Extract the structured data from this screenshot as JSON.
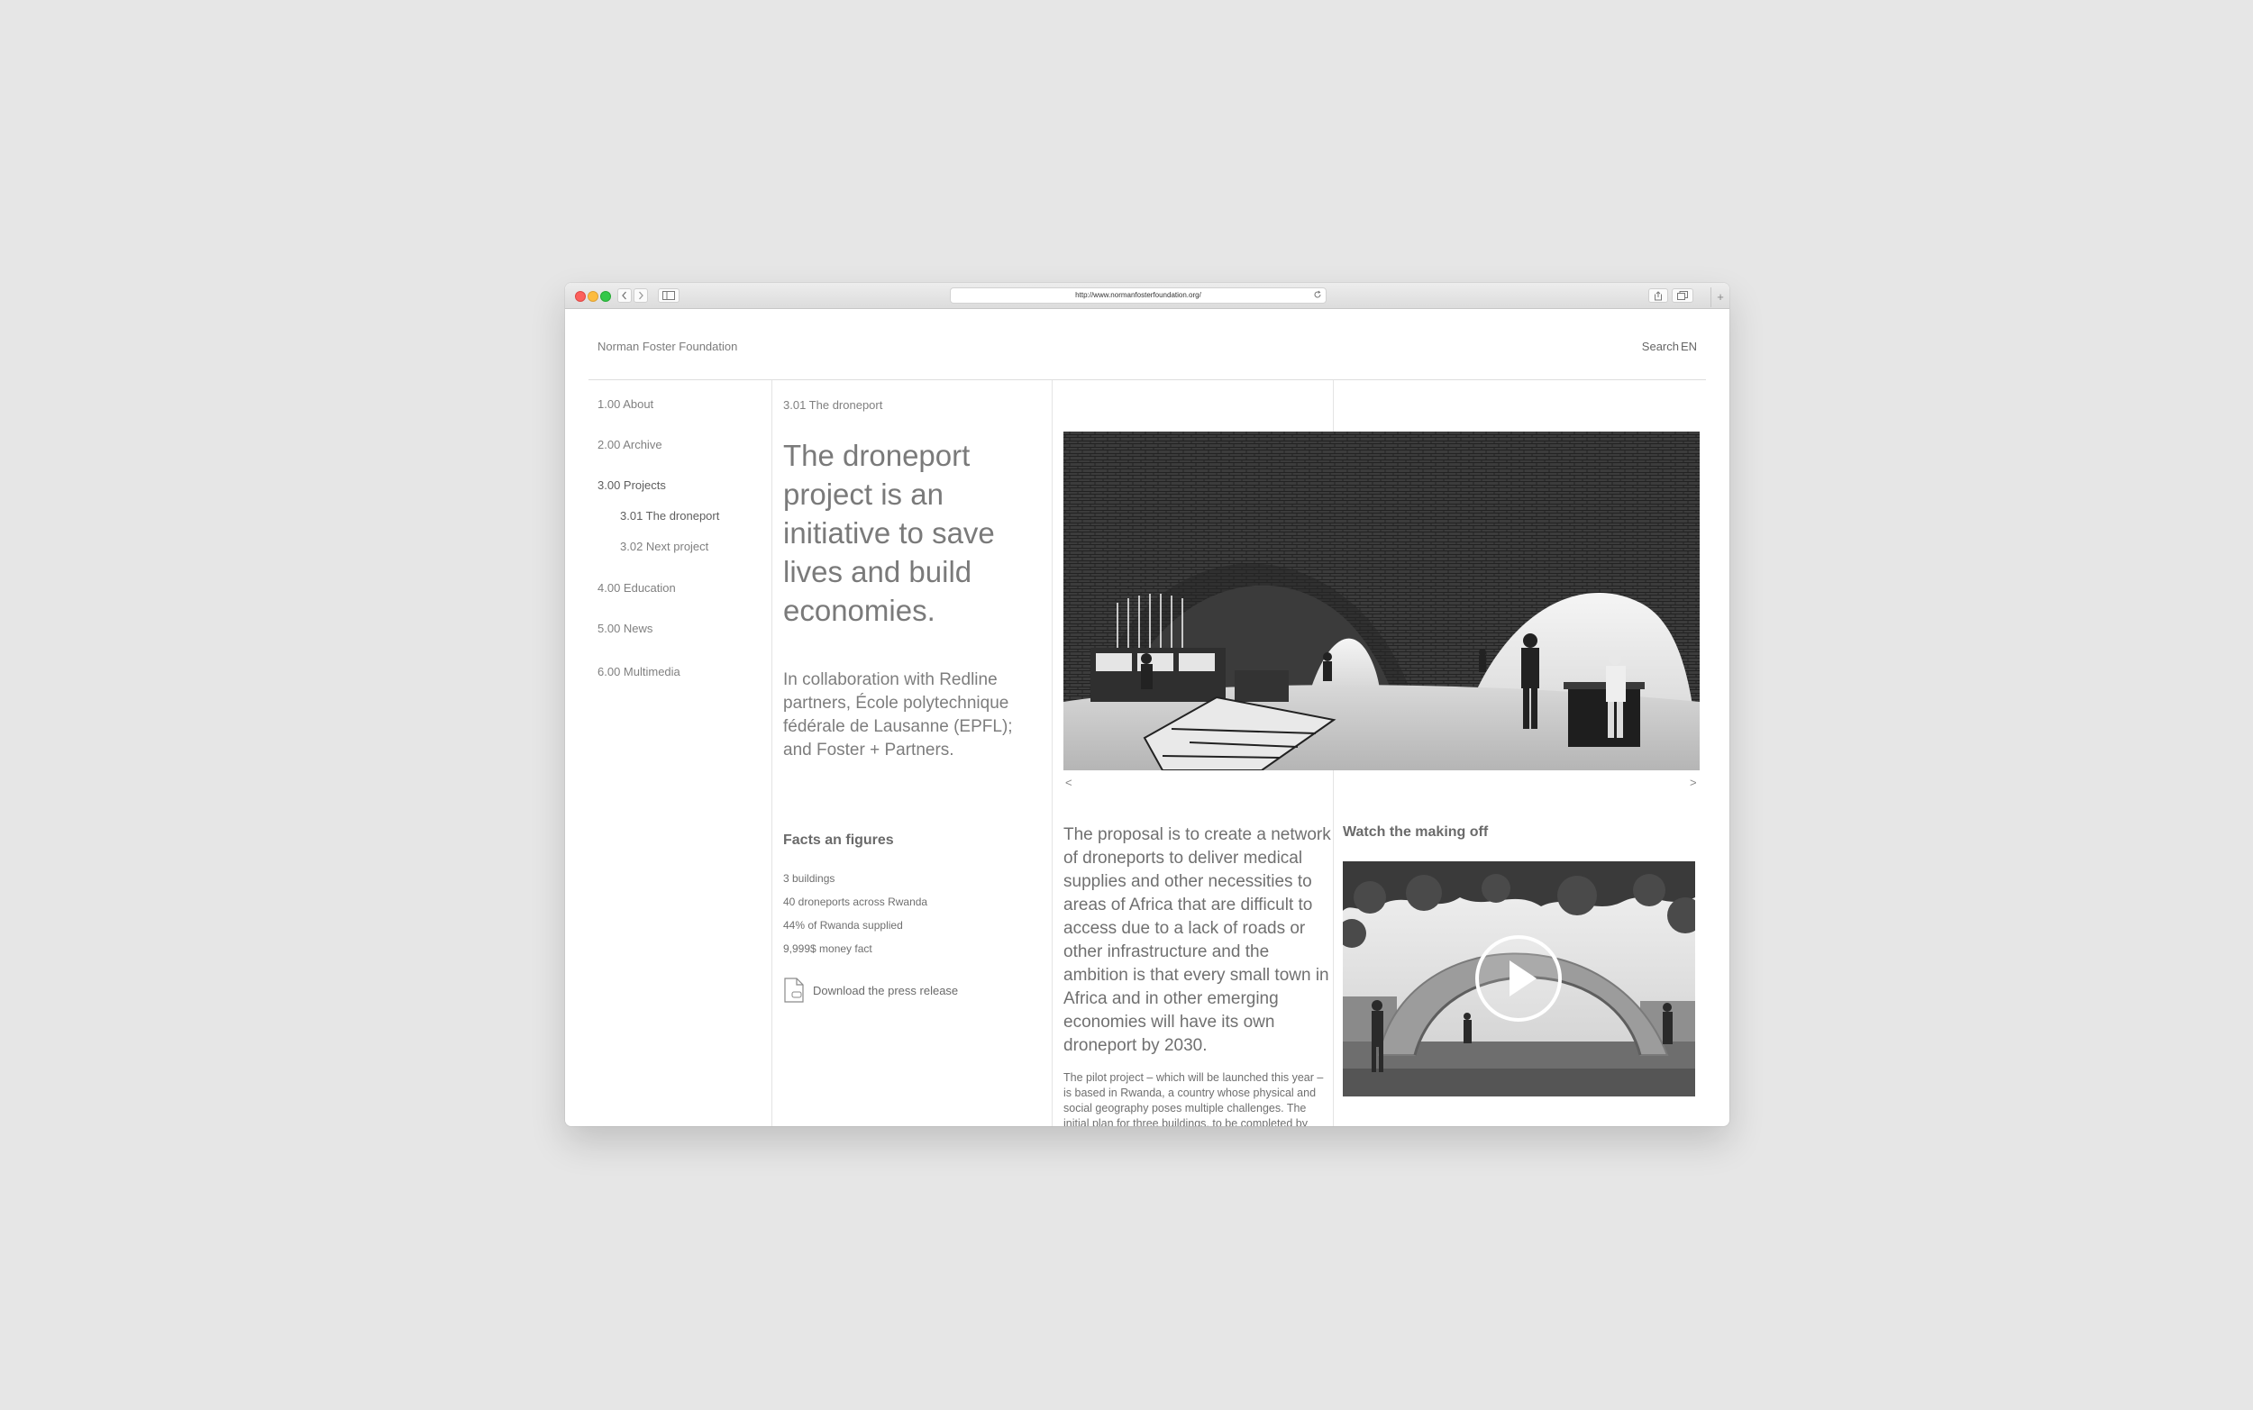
{
  "browser": {
    "url": "http://www.normanfosterfoundation.org/"
  },
  "header": {
    "brand": "Norman Foster Foundation",
    "search": "Search",
    "language": "EN"
  },
  "nav": {
    "items": [
      {
        "label": "1.00 About"
      },
      {
        "label": "2.00 Archive"
      },
      {
        "label": "3.00 Projects"
      },
      {
        "label": "3.01 The droneport"
      },
      {
        "label": "3.02 Next project"
      },
      {
        "label": "4.00 Education"
      },
      {
        "label": "5.00 News"
      },
      {
        "label": "6.00 Multimedia"
      }
    ]
  },
  "content": {
    "breadcrumb": "3.01 The droneport",
    "headline": "The droneport project is an initiative to save lives and build economies.",
    "collaboration": "In collaboration with Redline partners, École polytechnique fédérale de Lausanne (EPFL); and Foster + Partners.",
    "facts_title": "Facts an figures",
    "facts": [
      "3 buildings",
      "40 droneports across Rwanda",
      "44% of Rwanda supplied",
      "9,999$ money fact"
    ],
    "download_label": "Download the press release",
    "gallery_prev": "<",
    "gallery_next": ">",
    "proposal": "The proposal is to create a network of droneports to deliver medical supplies and other necessities to areas of Africa that are difficult to access due to a lack of roads or other infrastructure and the ambition is that every small town in Africa and in other emerging economies will have its own droneport by 2030.",
    "pilot": "The pilot project – which will be launched this year – is based in Rwanda, a country whose physical and social geography poses multiple challenges. The initial plan for three buildings, to be completed by",
    "video_title": "Watch the making off"
  },
  "icons": {
    "doc": "document-icon",
    "play": "play-icon"
  }
}
